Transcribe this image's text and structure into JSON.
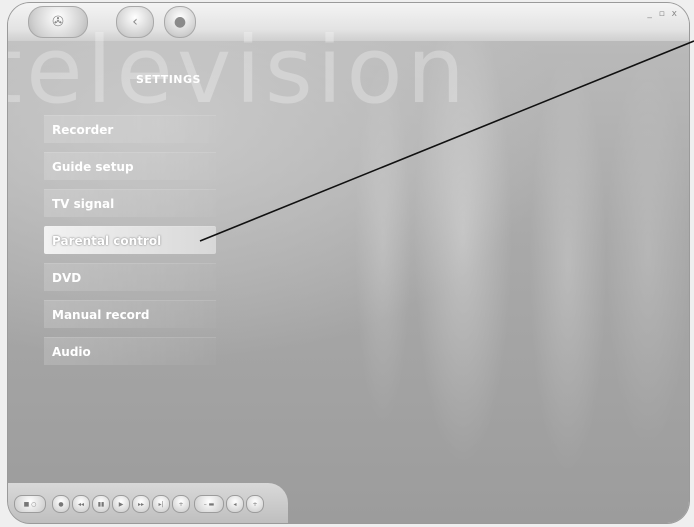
{
  "window": {
    "watermark": "television",
    "section_title": "SETTINGS",
    "window_controls": "_ ▫ x"
  },
  "titlebar": {
    "main_icon": "windows-logo-icon",
    "back_icon": "back-arrow-icon",
    "start_icon": "start-icon"
  },
  "menu": {
    "items": [
      {
        "label": "Recorder"
      },
      {
        "label": "Guide setup"
      },
      {
        "label": "TV signal"
      },
      {
        "label": "Parental control",
        "selected": true
      },
      {
        "label": "DVD"
      },
      {
        "label": "Manual record"
      },
      {
        "label": "Audio"
      }
    ]
  },
  "transport": {
    "buttons": [
      "stop-icon",
      "record-icon",
      "rewind-icon",
      "pause-icon",
      "play-icon",
      "forward-icon",
      "skip-icon",
      "channel-icon",
      "volume-down-icon",
      "mute-icon",
      "volume-up-icon"
    ]
  }
}
